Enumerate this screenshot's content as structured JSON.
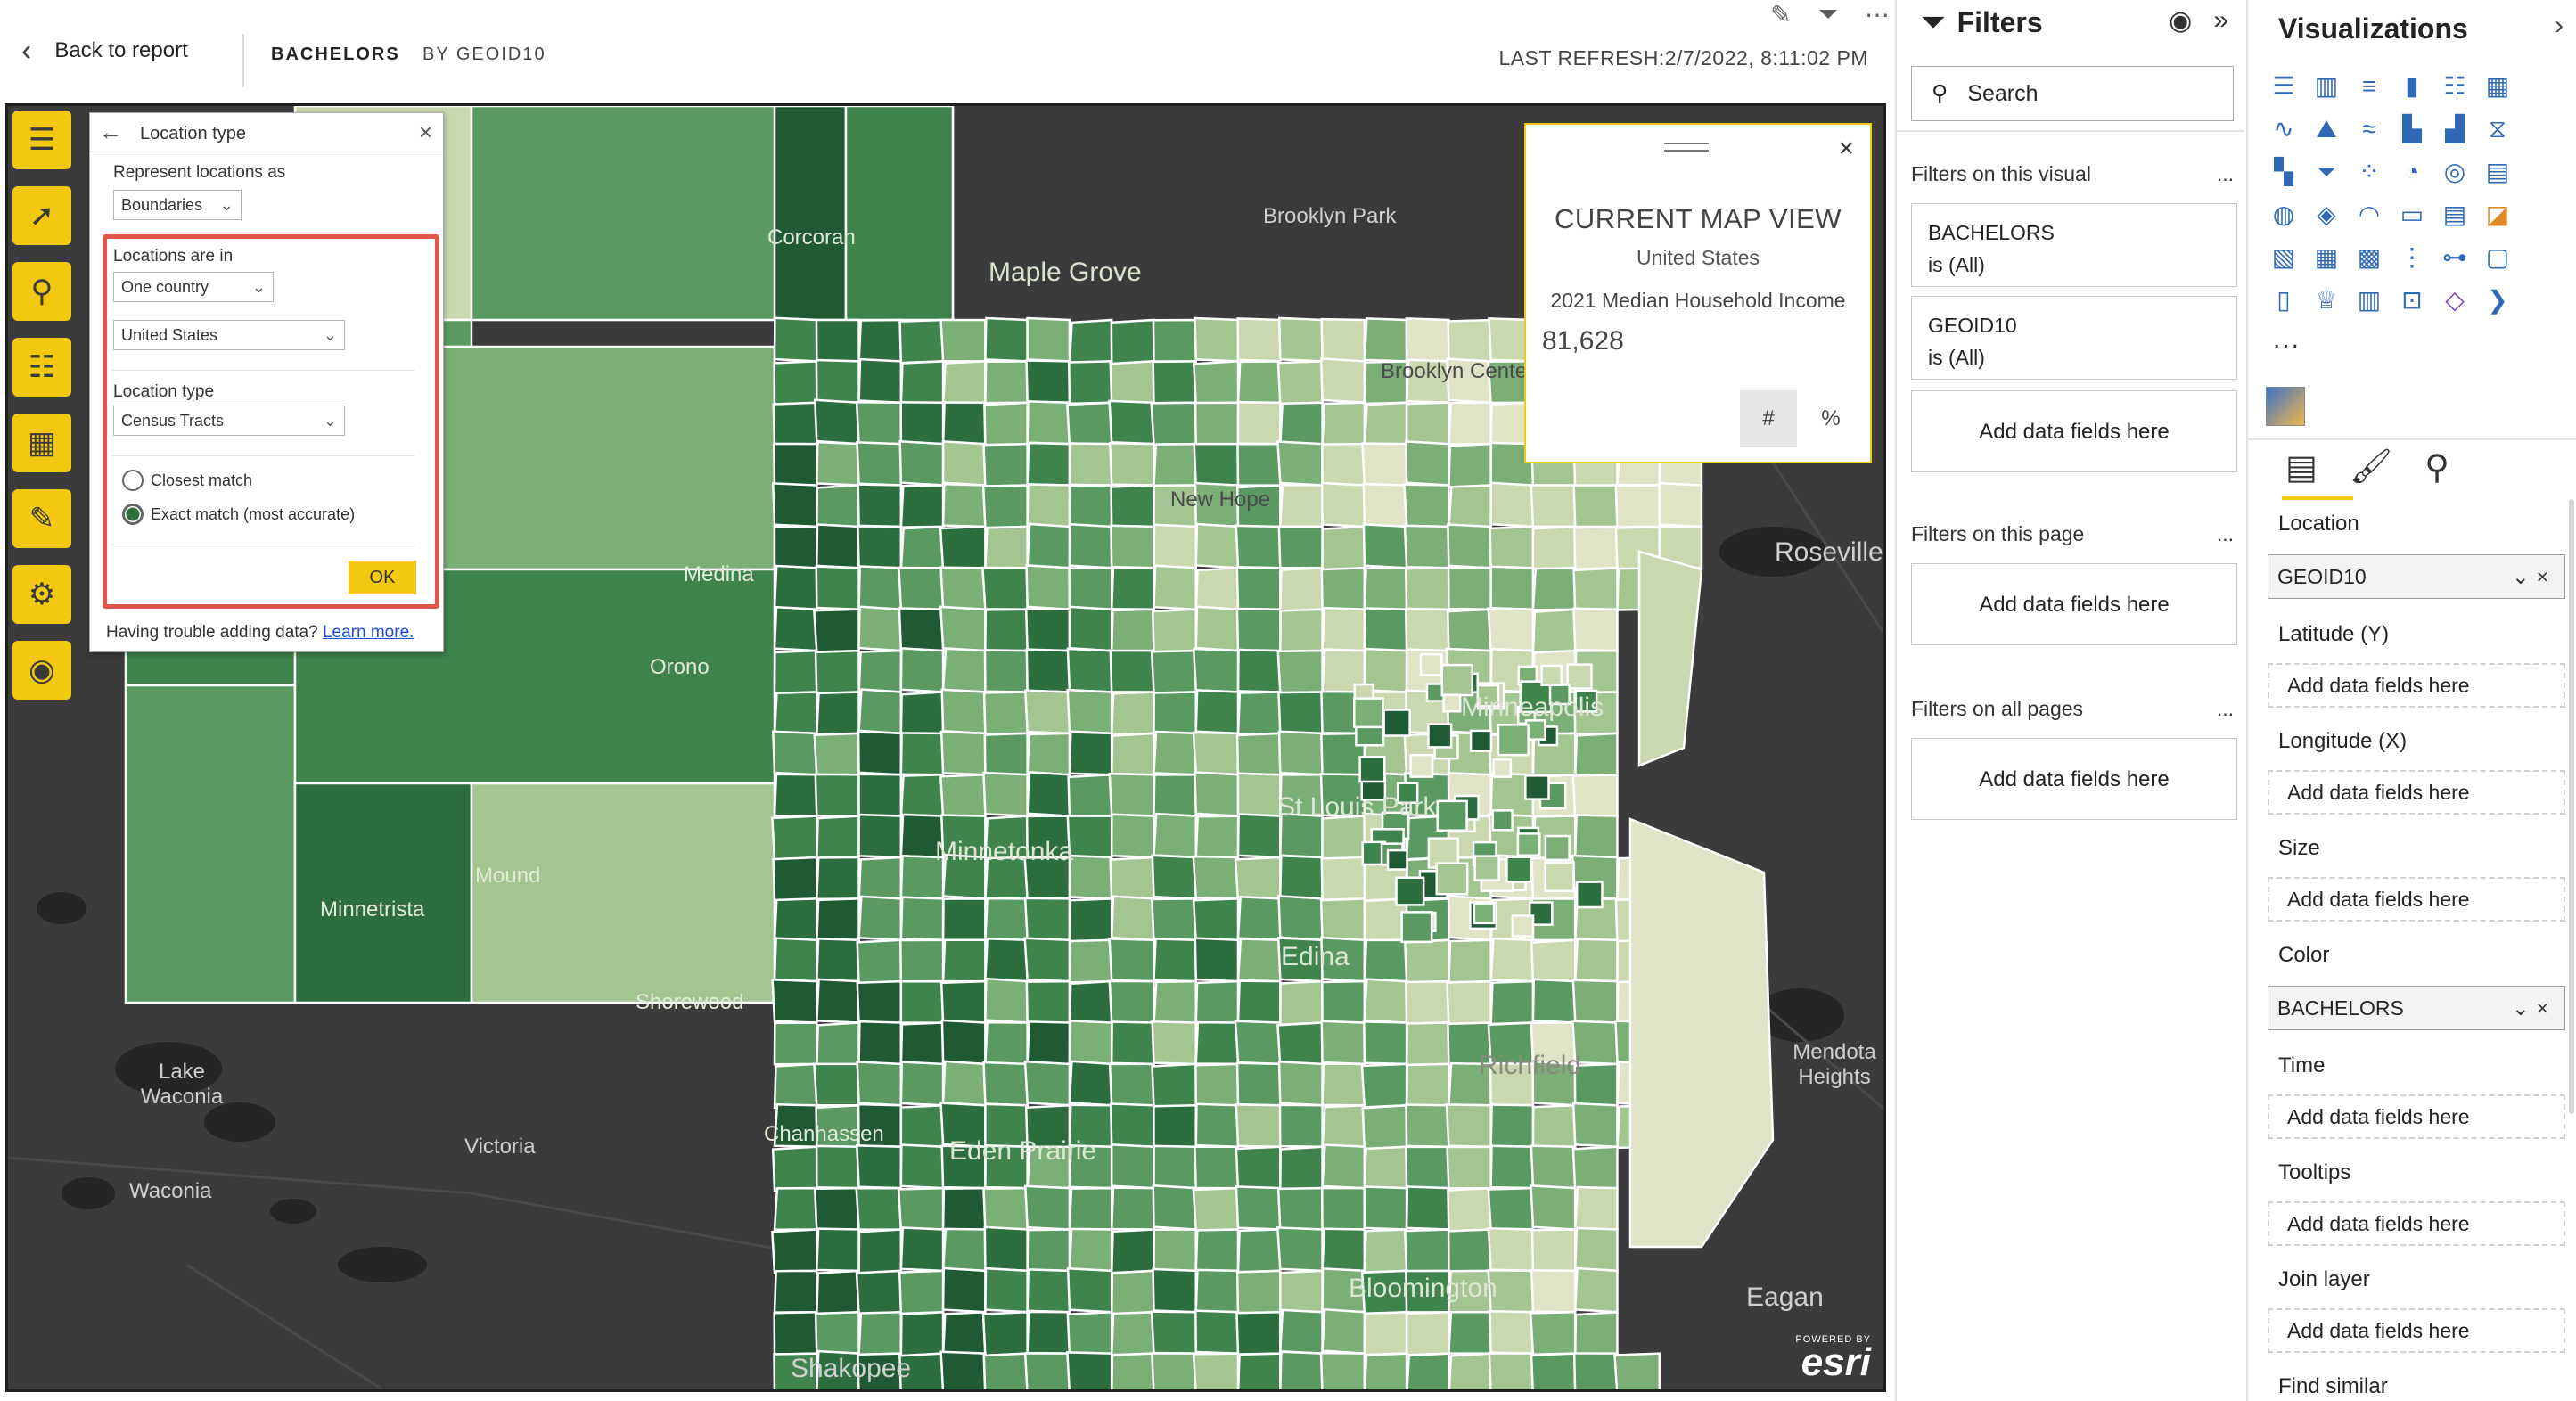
{
  "topbar": {
    "back_label": "Back to report",
    "crumb_main": "BACHELORS",
    "crumb_sub": "BY GEOID10",
    "last_refresh": "LAST REFRESH:2/7/2022, 8:11:02 PM",
    "icons": [
      "pin-icon",
      "filter-icon",
      "more-icon"
    ]
  },
  "map": {
    "labels": [
      "Brooklyn Park",
      "Maple Grove",
      "Corcoran",
      "Brooklyn Center",
      "New Hope",
      "Medina",
      "Orono",
      "Roseville",
      "Minneapolis",
      "St Louis Park",
      "Minnetonka",
      "Mound",
      "Minnetrista",
      "Shorewood",
      "Edina",
      "Richfield",
      "Lake Waconia",
      "Victoria",
      "Waconia",
      "Chanhassen",
      "Eden Prairie",
      "Bloomington",
      "Mendota Heights",
      "Eagan",
      "Shakopee",
      "Minnetonka"
    ],
    "watermark_powered": "POWERED BY",
    "watermark_brand": "esri"
  },
  "tools": [
    "menu-icon",
    "select-icon",
    "search-icon",
    "layers-icon",
    "basemap-icon",
    "analysis-icon",
    "settings-icon",
    "user-icon"
  ],
  "location_dialog": {
    "title": "Location type",
    "represent_label": "Represent locations as",
    "represent_value": "Boundaries",
    "locations_in_label": "Locations are in",
    "locations_in_value": "One country",
    "country_value": "United States",
    "location_type_label": "Location type",
    "location_type_value": "Census Tracts",
    "radio_closest": "Closest match",
    "radio_exact": "Exact match (most accurate)",
    "ok_label": "OK",
    "trouble_text": "Having trouble adding data?",
    "learn_more": "Learn more."
  },
  "map_card": {
    "title": "CURRENT MAP VIEW",
    "region": "United States",
    "metric": "2021 Median Household Income",
    "value": "81,628",
    "btn_number": "#",
    "btn_percent": "%"
  },
  "filters": {
    "title": "Filters",
    "search_placeholder": "Search",
    "on_visual": "Filters on this visual",
    "card1_field": "BACHELORS",
    "card1_state": "is (All)",
    "card2_field": "GEOID10",
    "card2_state": "is (All)",
    "add_fields": "Add data fields here",
    "on_page": "Filters on this page",
    "on_all": "Filters on all pages",
    "more": "..."
  },
  "visualizations": {
    "title": "Visualizations",
    "more": "...",
    "location_label": "Location",
    "location_value": "GEOID10",
    "latitude_label": "Latitude (Y)",
    "longitude_label": "Longitude (X)",
    "size_label": "Size",
    "color_label": "Color",
    "color_value": "BACHELORS",
    "time_label": "Time",
    "tooltips_label": "Tooltips",
    "join_label": "Join layer",
    "find_label": "Find similar",
    "add_fields": "Add data fields here"
  },
  "colors": {
    "accent": "#f2c811",
    "highlight": "#e0554c",
    "map_bg": "#3c3b3c",
    "choropleth": [
      "#1f5a32",
      "#2d6e3e",
      "#3f834d",
      "#5a9a62",
      "#7cae78",
      "#a3c592",
      "#c9d8ae",
      "#e0e3c6"
    ]
  }
}
